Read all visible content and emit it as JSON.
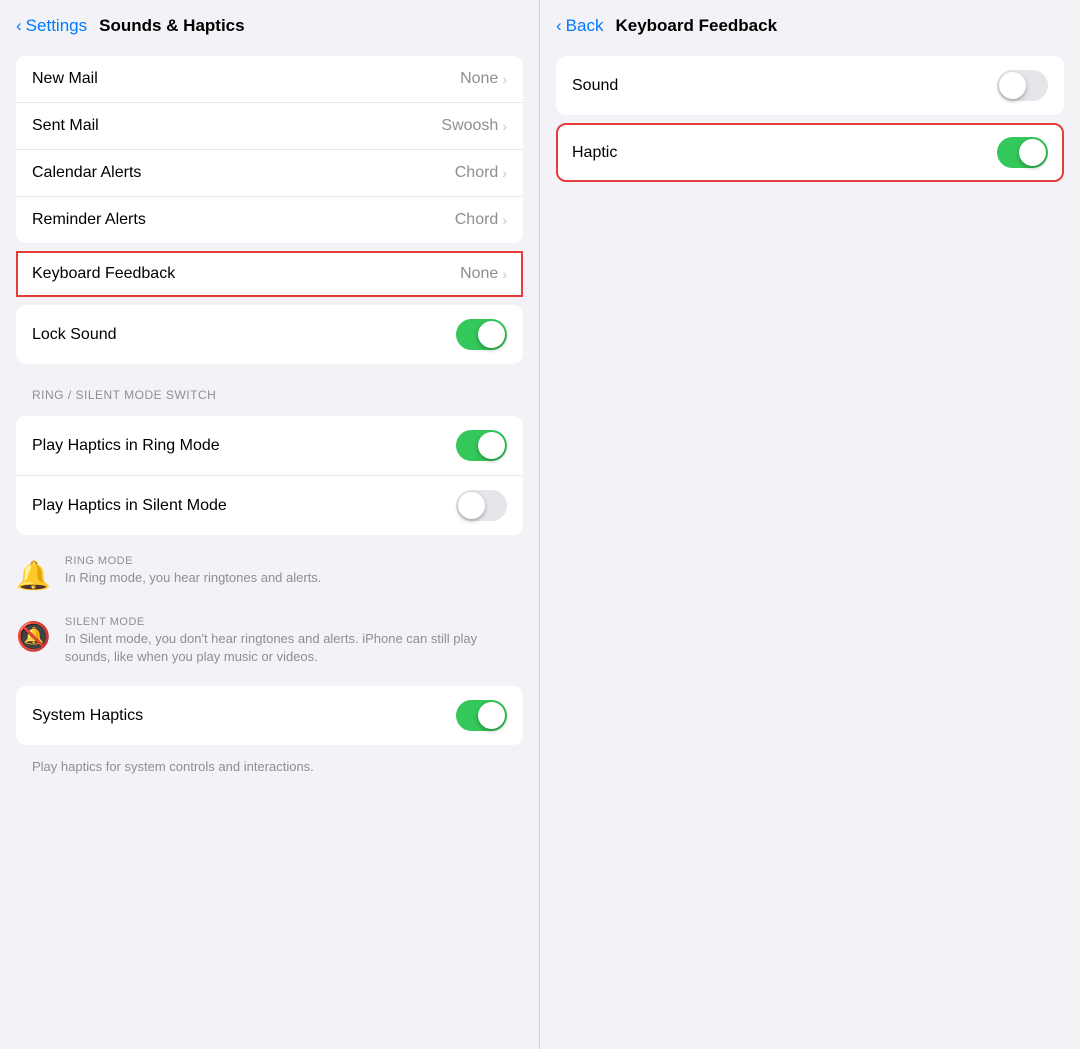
{
  "left": {
    "nav": {
      "back_label": "Settings",
      "title": "Sounds & Haptics"
    },
    "mail_group": [
      {
        "id": "new-mail",
        "label": "New Mail",
        "value": "None",
        "has_chevron": true
      },
      {
        "id": "sent-mail",
        "label": "Sent Mail",
        "value": "Swoosh",
        "has_chevron": true
      },
      {
        "id": "calendar-alerts",
        "label": "Calendar Alerts",
        "value": "Chord",
        "has_chevron": true
      },
      {
        "id": "reminder-alerts",
        "label": "Reminder Alerts",
        "value": "Chord",
        "has_chevron": true
      }
    ],
    "keyboard_feedback": {
      "label": "Keyboard Feedback",
      "value": "None",
      "has_chevron": true,
      "highlighted": true
    },
    "lock_sound": {
      "label": "Lock Sound",
      "toggle": "on"
    },
    "ring_silent_header": "Ring / Silent Mode Switch",
    "ring_silent_group": [
      {
        "id": "play-haptics-ring",
        "label": "Play Haptics in Ring Mode",
        "toggle": "on"
      },
      {
        "id": "play-haptics-silent",
        "label": "Play Haptics in Silent Mode",
        "toggle": "off"
      }
    ],
    "ring_mode_info": {
      "icon": "🔔",
      "title": "Ring Mode",
      "desc": "In Ring mode, you hear ringtones and alerts."
    },
    "silent_mode_info": {
      "icon": "🔕",
      "title": "Silent Mode",
      "desc": "In Silent mode, you don't hear ringtones and alerts. iPhone can still play sounds, like when you play music or videos."
    },
    "system_haptics": {
      "label": "System Haptics",
      "toggle": "on"
    },
    "system_haptics_note": "Play haptics for system controls and interactions."
  },
  "right": {
    "nav": {
      "back_label": "Back",
      "title": "Keyboard Feedback"
    },
    "rows": [
      {
        "id": "sound-toggle",
        "label": "Sound",
        "toggle": "off",
        "highlighted": false
      },
      {
        "id": "haptic-toggle",
        "label": "Haptic",
        "toggle": "on",
        "highlighted": true
      }
    ]
  }
}
